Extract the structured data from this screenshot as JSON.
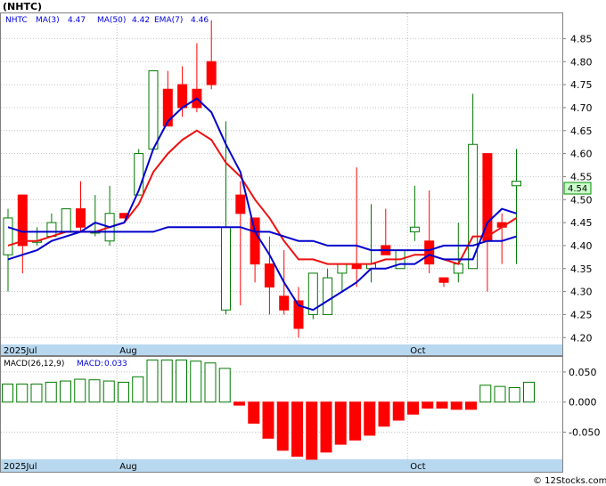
{
  "symbol_title": "(NHTC)",
  "legend": {
    "ticker": "NHTC",
    "ma3": "MA(3)",
    "ma3_value": "4.47",
    "ma50": "MA(50)",
    "ma50_value": "4.42",
    "ema7": "EMA(7)",
    "ema7_value": "4.46"
  },
  "last_price_label": "4.54",
  "macd_legend": {
    "params": "MACD(26,12,9)",
    "label": "MACD:",
    "value": "0.033"
  },
  "footer": "© 12Stocks.com",
  "colors": {
    "up_candle": "#007a00",
    "down_candle": "#ff0000",
    "ma_blue": "#0000cc",
    "ema_red": "#ee1111",
    "date_band": "#b8d8f0",
    "grid": "#c0c0c0",
    "legend_text": "#0000dd"
  },
  "chart_data": [
    {
      "type": "candlestick",
      "ylim": [
        4.185,
        4.905
      ],
      "y_ticks": [
        "4.20",
        "4.25",
        "4.30",
        "4.35",
        "4.40",
        "4.45",
        "4.50",
        "4.55",
        "4.60",
        "4.65",
        "4.70",
        "4.75",
        "4.80",
        "4.85"
      ],
      "x_tick_labels": [
        "2025Jul",
        "Aug",
        "Oct"
      ],
      "candles": [
        {
          "open": 4.38,
          "high": 4.48,
          "low": 4.3,
          "close": 4.46
        },
        {
          "open": 4.51,
          "high": 4.51,
          "low": 4.34,
          "close": 4.4
        },
        {
          "open": 4.41,
          "high": 4.44,
          "low": 4.4,
          "close": 4.41
        },
        {
          "open": 4.42,
          "high": 4.47,
          "low": 4.42,
          "close": 4.45
        },
        {
          "open": 4.43,
          "high": 4.48,
          "low": 4.43,
          "close": 4.48
        },
        {
          "open": 4.48,
          "high": 4.54,
          "low": 4.43,
          "close": 4.44
        },
        {
          "open": 4.43,
          "high": 4.51,
          "low": 4.42,
          "close": 4.43
        },
        {
          "open": 4.41,
          "high": 4.53,
          "low": 4.4,
          "close": 4.47
        },
        {
          "open": 4.47,
          "high": 4.47,
          "low": 4.46,
          "close": 4.46
        },
        {
          "open": 4.51,
          "high": 4.61,
          "low": 4.51,
          "close": 4.6
        },
        {
          "open": 4.61,
          "high": 4.78,
          "low": 4.61,
          "close": 4.78
        },
        {
          "open": 4.74,
          "high": 4.78,
          "low": 4.67,
          "close": 4.66
        },
        {
          "open": 4.75,
          "high": 4.79,
          "low": 4.68,
          "close": 4.7
        },
        {
          "open": 4.74,
          "high": 4.84,
          "low": 4.69,
          "close": 4.7
        },
        {
          "open": 4.8,
          "high": 4.89,
          "low": 4.74,
          "close": 4.75
        },
        {
          "open": 4.26,
          "high": 4.67,
          "low": 4.25,
          "close": 4.44
        },
        {
          "open": 4.51,
          "high": 4.54,
          "low": 4.27,
          "close": 4.47
        },
        {
          "open": 4.46,
          "high": 4.46,
          "low": 4.32,
          "close": 4.36
        },
        {
          "open": 4.36,
          "high": 4.42,
          "low": 4.25,
          "close": 4.31
        },
        {
          "open": 4.29,
          "high": 4.39,
          "low": 4.25,
          "close": 4.26
        },
        {
          "open": 4.28,
          "high": 4.31,
          "low": 4.2,
          "close": 4.22
        },
        {
          "open": 4.25,
          "high": 4.34,
          "low": 4.24,
          "close": 4.34
        },
        {
          "open": 4.25,
          "high": 4.35,
          "low": 4.25,
          "close": 4.33
        },
        {
          "open": 4.34,
          "high": 4.36,
          "low": 4.3,
          "close": 4.36
        },
        {
          "open": 4.36,
          "high": 4.57,
          "low": 4.31,
          "close": 4.35
        },
        {
          "open": 4.35,
          "high": 4.49,
          "low": 4.32,
          "close": 4.36
        },
        {
          "open": 4.4,
          "high": 4.48,
          "low": 4.38,
          "close": 4.38
        },
        {
          "open": 4.35,
          "high": 4.39,
          "low": 4.35,
          "close": 4.39
        },
        {
          "open": 4.43,
          "high": 4.53,
          "low": 4.41,
          "close": 4.44
        },
        {
          "open": 4.41,
          "high": 4.52,
          "low": 4.34,
          "close": 4.36
        },
        {
          "open": 4.33,
          "high": 4.33,
          "low": 4.31,
          "close": 4.32
        },
        {
          "open": 4.34,
          "high": 4.45,
          "low": 4.32,
          "close": 4.36
        },
        {
          "open": 4.35,
          "high": 4.73,
          "low": 4.35,
          "close": 4.62
        },
        {
          "open": 4.6,
          "high": 4.6,
          "low": 4.3,
          "close": 4.41
        },
        {
          "open": 4.45,
          "high": 4.47,
          "low": 4.36,
          "close": 4.44
        },
        {
          "open": 4.53,
          "high": 4.61,
          "low": 4.36,
          "close": 4.54
        }
      ],
      "ma3": [
        4.37,
        4.38,
        4.39,
        4.41,
        4.42,
        4.43,
        4.45,
        4.44,
        4.45,
        4.52,
        4.61,
        4.67,
        4.7,
        4.72,
        4.69,
        4.62,
        4.56,
        4.43,
        4.38,
        4.32,
        4.27,
        4.26,
        4.28,
        4.3,
        4.32,
        4.35,
        4.35,
        4.36,
        4.36,
        4.38,
        4.37,
        4.37,
        4.37,
        4.45,
        4.48,
        4.47
      ],
      "ma50": [
        4.44,
        4.43,
        4.43,
        4.43,
        4.43,
        4.43,
        4.43,
        4.43,
        4.43,
        4.43,
        4.43,
        4.44,
        4.44,
        4.44,
        4.44,
        4.44,
        4.44,
        4.43,
        4.43,
        4.42,
        4.41,
        4.41,
        4.4,
        4.4,
        4.4,
        4.39,
        4.39,
        4.39,
        4.39,
        4.39,
        4.4,
        4.4,
        4.4,
        4.41,
        4.41,
        4.42
      ],
      "ema7": [
        4.4,
        4.41,
        4.41,
        4.42,
        4.43,
        4.43,
        4.43,
        4.44,
        4.45,
        4.49,
        4.56,
        4.6,
        4.63,
        4.65,
        4.63,
        4.58,
        4.55,
        4.5,
        4.46,
        4.41,
        4.37,
        4.37,
        4.36,
        4.36,
        4.36,
        4.36,
        4.37,
        4.37,
        4.38,
        4.38,
        4.37,
        4.36,
        4.42,
        4.42,
        4.44,
        4.46
      ]
    },
    {
      "type": "bar",
      "name": "MACD(26,12,9)",
      "ylim": [
        -0.095,
        0.075
      ],
      "y_ticks": [
        "0.050",
        "0.000",
        "-0.050"
      ],
      "x_tick_labels": [
        "2025Jul",
        "Aug",
        "Oct"
      ],
      "values": [
        0.03,
        0.03,
        0.03,
        0.033,
        0.035,
        0.038,
        0.037,
        0.035,
        0.033,
        0.042,
        0.07,
        0.07,
        0.07,
        0.068,
        0.065,
        0.056,
        -0.005,
        -0.035,
        -0.06,
        -0.08,
        -0.09,
        -0.095,
        -0.083,
        -0.07,
        -0.063,
        -0.055,
        -0.04,
        -0.03,
        -0.02,
        -0.01,
        -0.01,
        -0.012,
        -0.012,
        0.028,
        0.026,
        0.024,
        0.033
      ]
    }
  ]
}
